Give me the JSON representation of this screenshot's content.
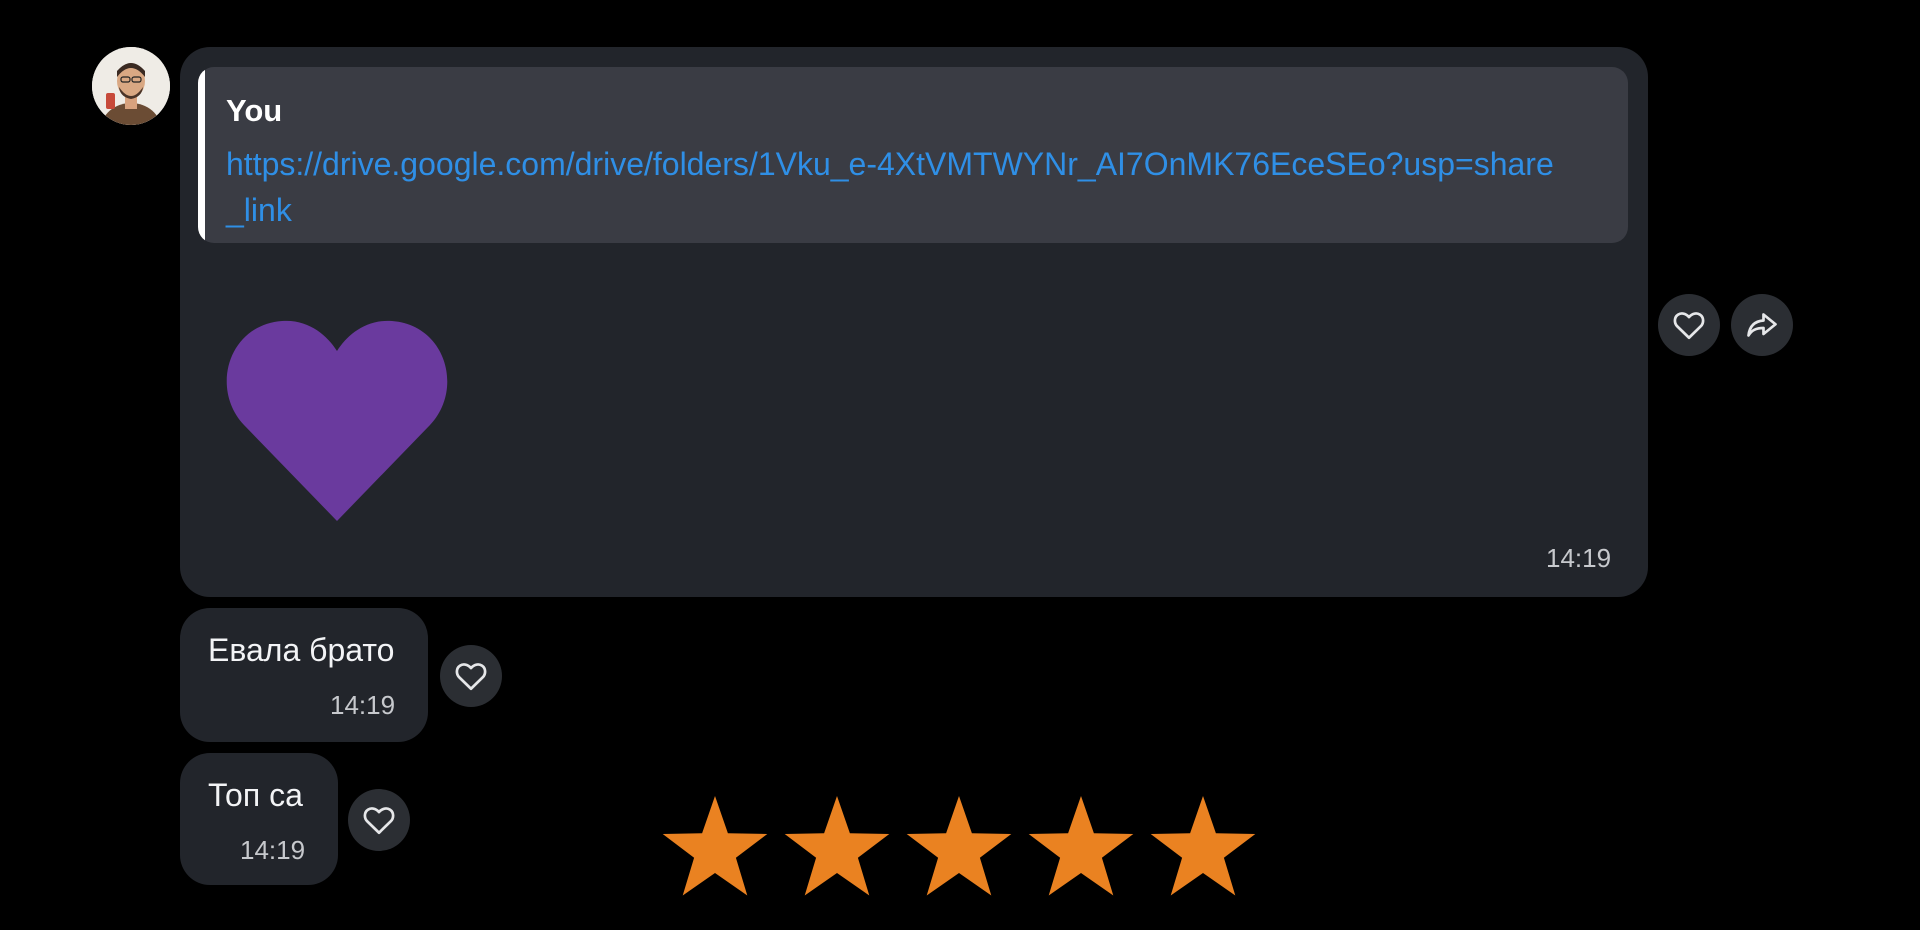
{
  "message_group": {
    "avatar_icon": "user-avatar-photo",
    "main_message": {
      "reply": {
        "author": "You",
        "link": "https://drive.google.com/drive/folders/1Vku_e-4XtVMTWYNr_AI7OnMK76EceSEo?usp=share_link"
      },
      "sticker": "purple-heart-sticker",
      "sticker_color": "#6a3a9e",
      "time": "14:19",
      "actions": [
        "heart-react-icon",
        "forward-icon"
      ]
    },
    "messages": [
      {
        "text": "Евала брато",
        "time": "14:19"
      },
      {
        "text": "Топ са",
        "time": "14:19"
      }
    ]
  },
  "rating": {
    "value": 5,
    "max": 5,
    "color": "#ea8221",
    "icon": "star-icon"
  }
}
